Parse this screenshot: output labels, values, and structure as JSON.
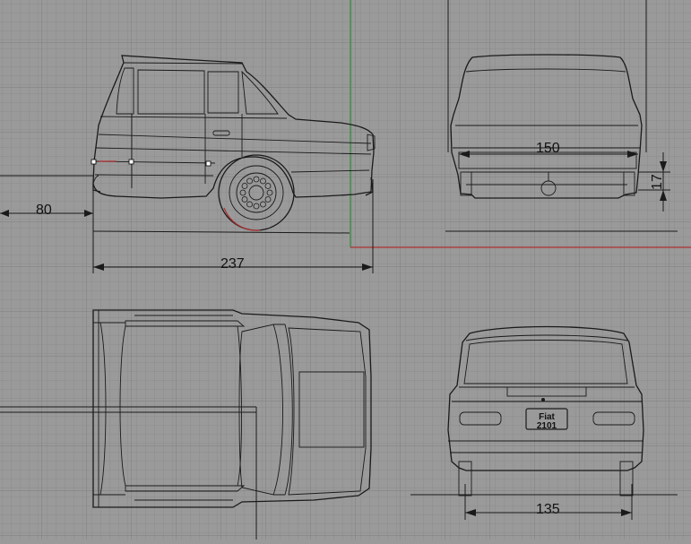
{
  "viewport": {
    "background": "#9a9a9a",
    "grid_color": "#8a8a8a",
    "grid_major_color": "#7e7e7e",
    "axis_x_color": "#b03030",
    "axis_y_color": "#2e8b3a"
  },
  "dimensions": {
    "rear_overhang": "80",
    "length": "237",
    "track_front": "150",
    "clearance": "17",
    "track_rear": "135"
  },
  "views": {
    "side_view": "side-view",
    "front_view": "front-view",
    "top_view": "top-view",
    "rear_view": "rear-view"
  },
  "license_plate": {
    "line1": "Fiat",
    "line2": "2101"
  }
}
